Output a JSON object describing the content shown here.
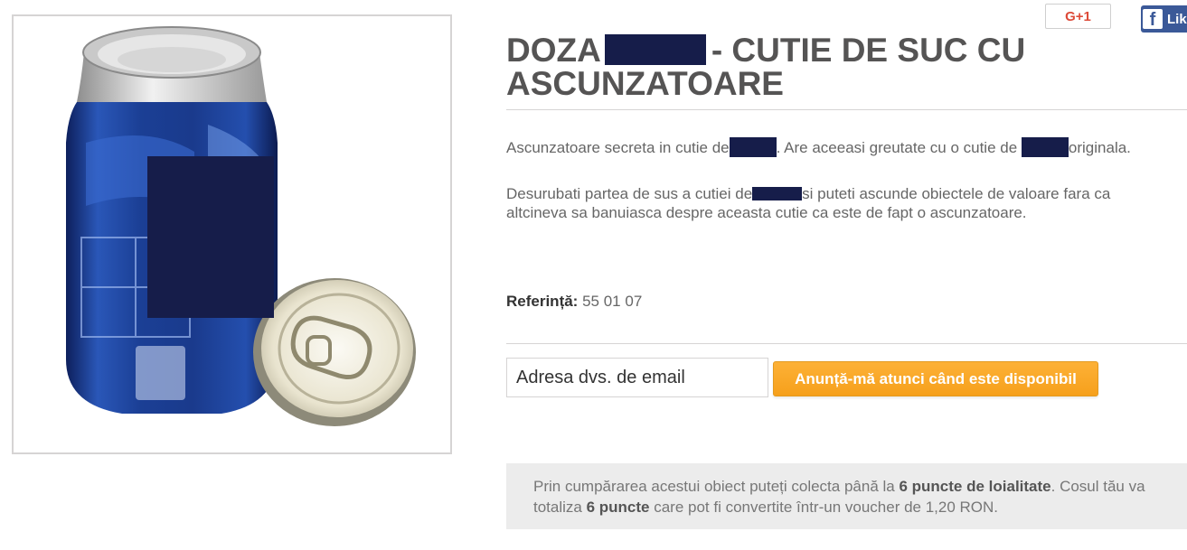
{
  "product": {
    "title_pre": "DOZA",
    "title_post": "- CUTIE DE SUC CU ASCUNZATOARE",
    "desc1_a": "Ascunzatoare secreta in cutie de",
    "desc1_b": ". Are aceeasi greutate cu o cutie de",
    "desc1_c": "originala.",
    "desc2_a": "Desurubati partea de sus a cutiei de",
    "desc2_b": "si puteti ascunde obiectele de valoare fara ca altcineva sa banuiasca despre aceasta cutie ca este de fapt o ascunzatoare.",
    "reference_label": "Referință:",
    "reference_value": "55 01 07"
  },
  "social": {
    "gplus_label": "G+1",
    "fb_logo": "f",
    "fb_label": "Lik"
  },
  "notify": {
    "email_placeholder": "Adresa dvs. de email",
    "button_label": "Anunță-mă atunci când este disponibil"
  },
  "loyalty": {
    "text_a": "Prin cumpărarea acestui obiect puteți colecta până la ",
    "points_a": "6 puncte de loialitate",
    "text_b": ". Cosul tău va totaliza ",
    "points_b": "6 puncte",
    "text_c": " care pot fi convertite într-un voucher de 1,20 RON."
  },
  "colors": {
    "redaction": "#161d4a",
    "accent": "#f6a01c",
    "title": "#555454"
  }
}
